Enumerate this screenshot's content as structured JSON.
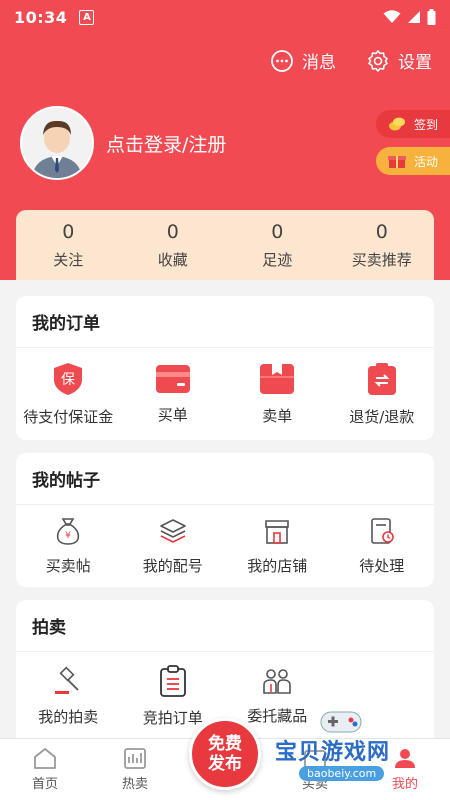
{
  "status_bar": {
    "time": "10:34",
    "badge": "A"
  },
  "header": {
    "messages_label": "消息",
    "settings_label": "设置",
    "login_text": "点击登录/注册",
    "sign_in_label": "签到",
    "activity_label": "活动"
  },
  "stats": [
    {
      "value": "0",
      "label": "关注"
    },
    {
      "value": "0",
      "label": "收藏"
    },
    {
      "value": "0",
      "label": "足迹"
    },
    {
      "value": "0",
      "label": "买卖推荐"
    }
  ],
  "orders": {
    "title": "我的订单",
    "shield_char": "保",
    "items": [
      {
        "label": "待支付保证金",
        "icon": "shield-icon"
      },
      {
        "label": "买单",
        "icon": "card-icon"
      },
      {
        "label": "卖单",
        "icon": "box-icon"
      },
      {
        "label": "退货/退款",
        "icon": "refund-icon"
      }
    ]
  },
  "posts": {
    "title": "我的帖子",
    "items": [
      {
        "label": "买卖帖",
        "icon": "money-bag-icon"
      },
      {
        "label": "我的配号",
        "icon": "layers-icon"
      },
      {
        "label": "我的店铺",
        "icon": "shop-icon"
      },
      {
        "label": "待处理",
        "icon": "pending-doc-icon"
      }
    ]
  },
  "auction": {
    "title": "拍卖",
    "items": [
      {
        "label": "我的拍卖",
        "icon": "gavel-icon"
      },
      {
        "label": "竞拍订单",
        "icon": "clipboard-icon"
      },
      {
        "label": "委托藏品",
        "icon": "people-icon"
      }
    ]
  },
  "tabbar": {
    "home": "首页",
    "hot": "热卖",
    "publish_line1": "免费",
    "publish_line2": "发布",
    "buy_sell": "买卖",
    "mine": "我的"
  },
  "watermark": {
    "text": "宝贝游戏网",
    "url": "baobeiy.com"
  },
  "colors": {
    "brand_red": "#f24a52",
    "accent_yellow": "#f6b23c",
    "stats_bg": "#fde6cf"
  }
}
